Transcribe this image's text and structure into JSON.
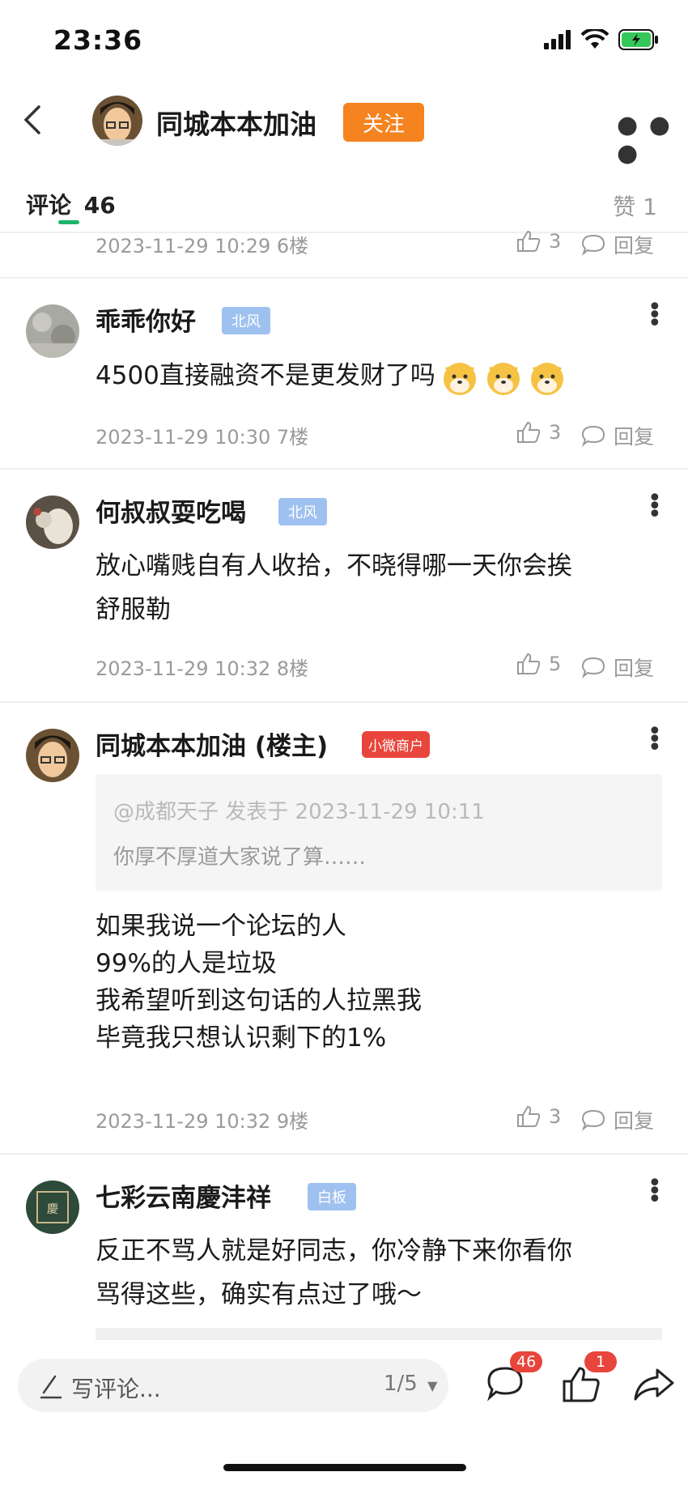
{
  "status": {
    "time": "23:36"
  },
  "header": {
    "title": "同城本本加油",
    "follow_label": "关注"
  },
  "tabs": {
    "comments_label": "评论",
    "comments_count": "46",
    "likes_label": "赞 1"
  },
  "top_partial": {
    "meta": "2023-11-29 10:29  6楼",
    "likes": "3",
    "reply": "回复"
  },
  "comments": [
    {
      "name": "乖乖你好",
      "badge": "北风",
      "text": "4500直接融资不是更发财了吗",
      "meta": "2023-11-29 10:30  7楼",
      "likes": "3",
      "reply": "回复"
    },
    {
      "name": "何叔叔耍吃喝",
      "badge": "北风",
      "text_lines": [
        "放心嘴贱自有人收拾，不晓得哪一天你会挨",
        "舒服勒"
      ],
      "meta": "2023-11-29 10:32  8楼",
      "likes": "5",
      "reply": "回复"
    },
    {
      "name": "同城本本加油 (楼主)",
      "badge": "小微商户",
      "quote_head": "@成都天子 发表于 2023-11-29 10:11",
      "quote_body": "你厚不厚道大家说了算……",
      "text_lines": [
        "如果我说一个论坛的人",
        "99%的人是垃圾",
        "我希望听到这句话的人拉黑我",
        "毕竟我只想认识剩下的1%"
      ],
      "meta": "2023-11-29 10:32  9楼",
      "likes": "3",
      "reply": "回复"
    },
    {
      "name": "七彩云南慶沣祥",
      "badge": "白板",
      "text_lines": [
        "反正不骂人就是好同志，你冷静下来你看你",
        "骂得这些，确实有点过了哦～"
      ]
    }
  ],
  "bottom": {
    "input_placeholder": "写评论...",
    "page_indicator": "1/5",
    "comments_badge": "46",
    "likes_badge": "1"
  },
  "colors": {
    "accent_orange": "#f5831f",
    "badge_blue": "#9fc1ef",
    "badge_red": "#e8453c",
    "tab_green": "#1fb46b"
  }
}
